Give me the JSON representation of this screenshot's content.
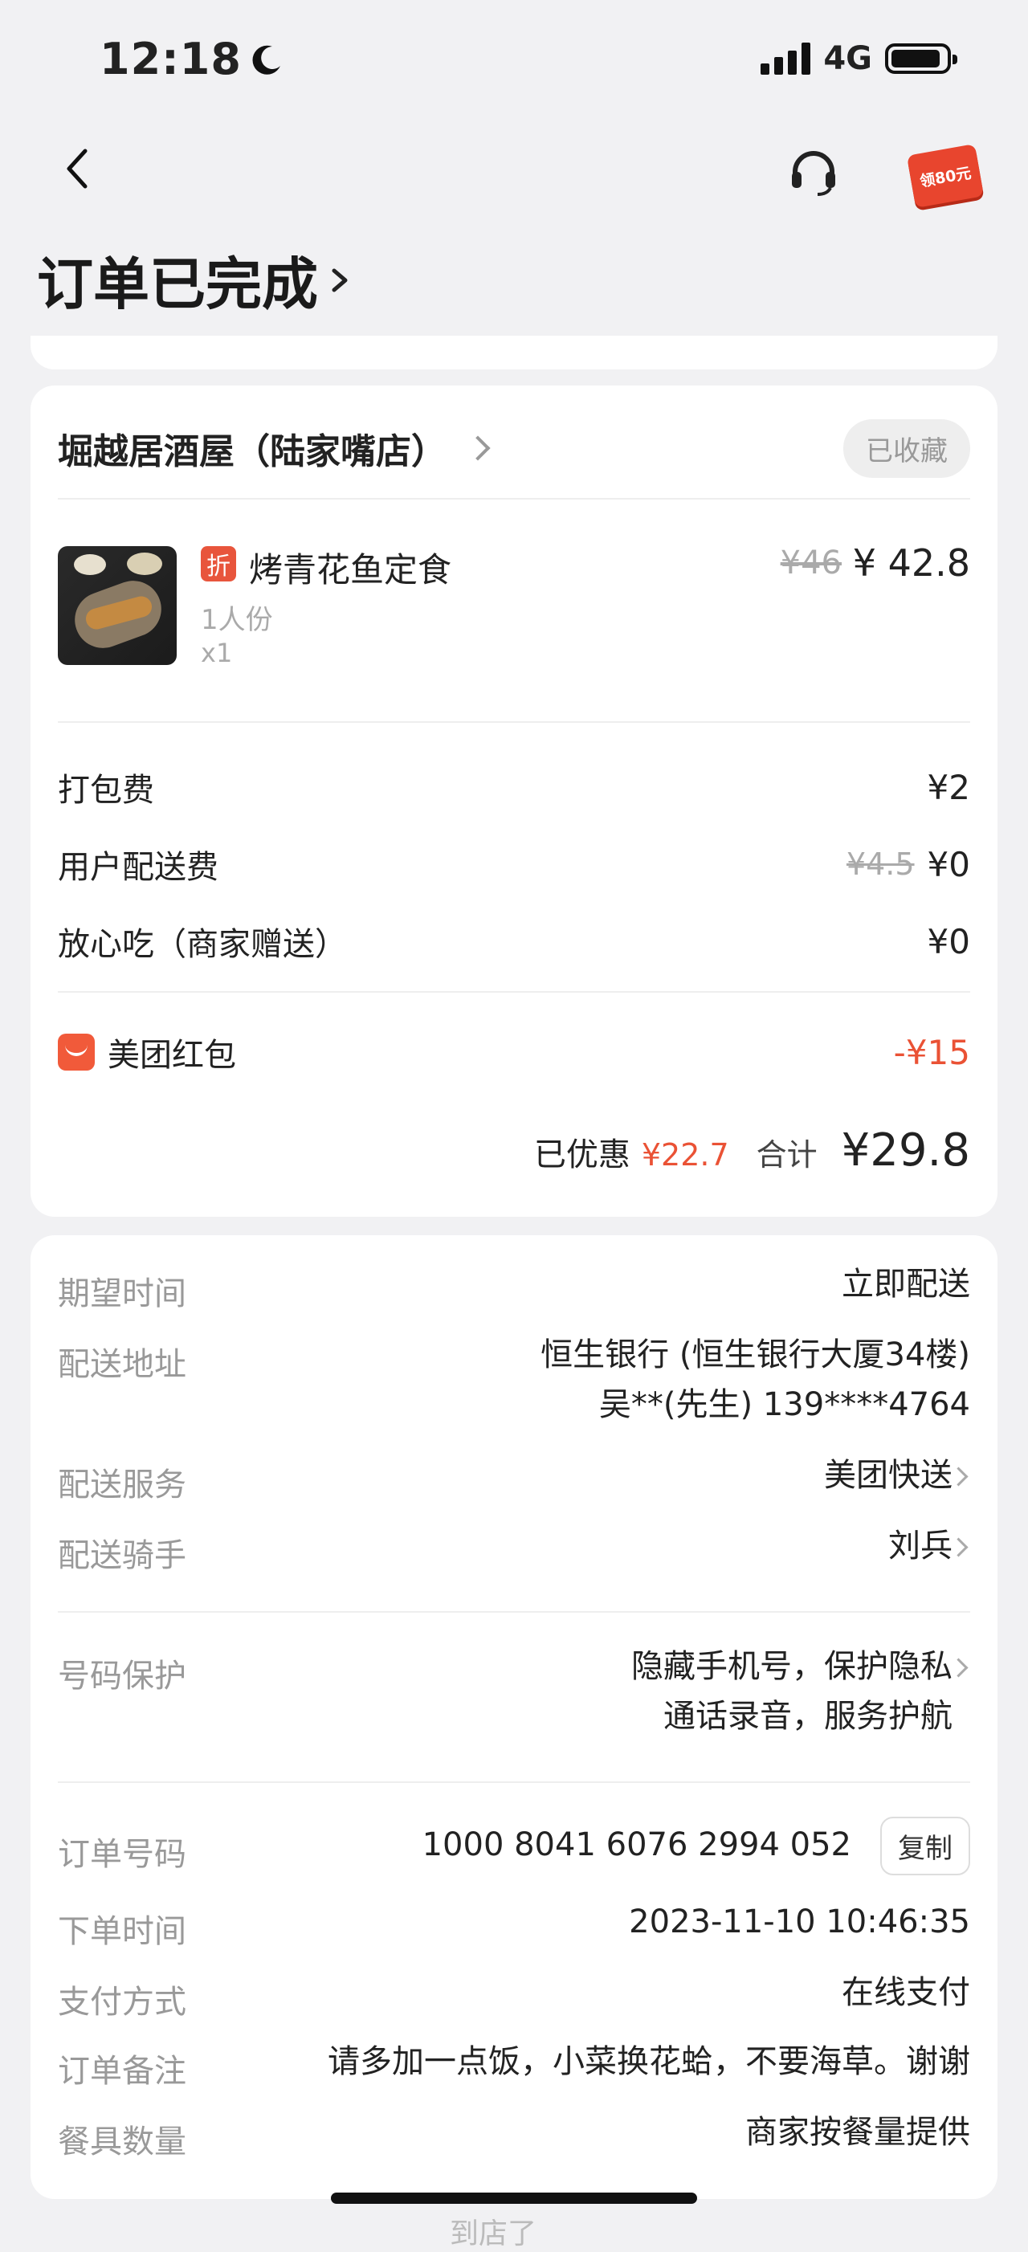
{
  "status_bar": {
    "time": "12:18",
    "network": "4G"
  },
  "header": {
    "title": "订单已完成",
    "promo_badge": "领80元"
  },
  "shop": {
    "name": "堀越居酒屋（陆家嘴店）",
    "fav_label": "已收藏"
  },
  "item": {
    "tag": "折",
    "name": "烤青花鱼定食",
    "spec": "1人份",
    "qty": "x1",
    "old_price": "¥46",
    "price": "¥ 42.8"
  },
  "fees": {
    "packing": {
      "label": "打包费",
      "value": "¥2"
    },
    "delivery": {
      "label": "用户配送费",
      "old": "¥4.5",
      "value": "¥0"
    },
    "assurance": {
      "label": "放心吃（商家赠送）",
      "value": "¥0"
    },
    "redpack": {
      "label": "美团红包",
      "value": "-¥15"
    }
  },
  "summary": {
    "saved_label": "已优惠",
    "saved_value": "¥22.7",
    "total_label": "合计",
    "total_value": "¥29.8"
  },
  "delivery_info": {
    "expect_time": {
      "key": "期望时间",
      "value": "立即配送"
    },
    "address": {
      "key": "配送地址",
      "line1": "恒生银行 (恒生银行大厦34楼)",
      "line2": "吴**(先生) 139****4764"
    },
    "service": {
      "key": "配送服务",
      "value": "美团快送"
    },
    "rider": {
      "key": "配送骑手",
      "value": "刘兵"
    },
    "privacy": {
      "key": "号码保护",
      "line1": "隐藏手机号，保护隐私",
      "line2": "通话录音，服务护航"
    }
  },
  "order_info": {
    "number": {
      "key": "订单号码",
      "value": "1000 8041 6076 2994 052",
      "copy_label": "复制"
    },
    "time": {
      "key": "下单时间",
      "value": "2023-11-10 10:46:35"
    },
    "payment": {
      "key": "支付方式",
      "value": "在线支付"
    },
    "note": {
      "key": "订单备注",
      "value": "请多加一点饭，小菜换花蛤，不要海草。谢谢"
    },
    "tableware": {
      "key": "餐具数量",
      "value": "商家按餐量提供"
    }
  },
  "footer_peek": "到店了",
  "colors": {
    "accent_red": "#ea5235",
    "background": "#f1f1f3"
  }
}
